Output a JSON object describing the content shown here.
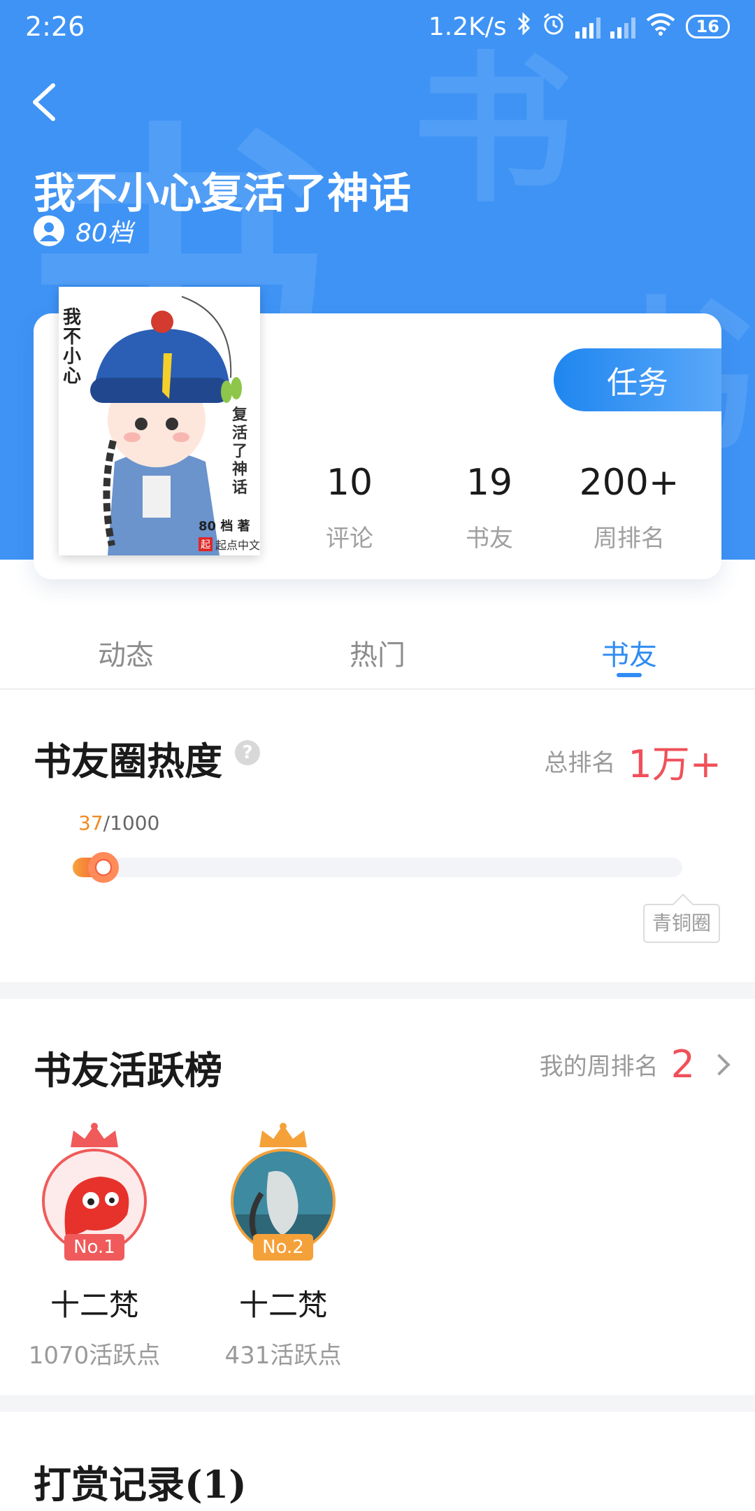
{
  "status": {
    "time": "2:26",
    "speed": "1.2K/s",
    "battery": "16"
  },
  "header": {
    "watermark": "书",
    "book_title": "我不小心复活了神话",
    "author": "80档"
  },
  "cover": {
    "title_text": "我不小心",
    "subtitle_text": "复活了神话",
    "author_text": "80 档 著",
    "publisher": "起点中文"
  },
  "card": {
    "task_label": "任务",
    "stats": [
      {
        "value": "10",
        "label": "评论"
      },
      {
        "value": "19",
        "label": "书友"
      },
      {
        "value": "200+",
        "label": "周排名"
      }
    ]
  },
  "tabs": [
    "动态",
    "热门",
    "书友"
  ],
  "active_tab": "书友",
  "heat": {
    "title": "书友圈热度",
    "help_icon": "question-icon",
    "rank_label": "总排名",
    "rank_value": "1万+",
    "progress_current": "37",
    "progress_total": "/1000",
    "progress_fraction": 0.037,
    "level_label": "青铜圈"
  },
  "active_board": {
    "title": "书友活跃榜",
    "my_rank_label": "我的周排名",
    "my_rank_value": "2",
    "members": [
      {
        "badge": "No.1",
        "name": "十二梵",
        "points": "1070活跃点"
      },
      {
        "badge": "No.2",
        "name": "十二梵",
        "points": "431活跃点"
      }
    ]
  },
  "rewards": {
    "title": "打赏记录(1)"
  },
  "colors": {
    "primary_blue": "#3e93f5",
    "accent_red": "#f0505a",
    "accent_orange": "#f08a25"
  }
}
